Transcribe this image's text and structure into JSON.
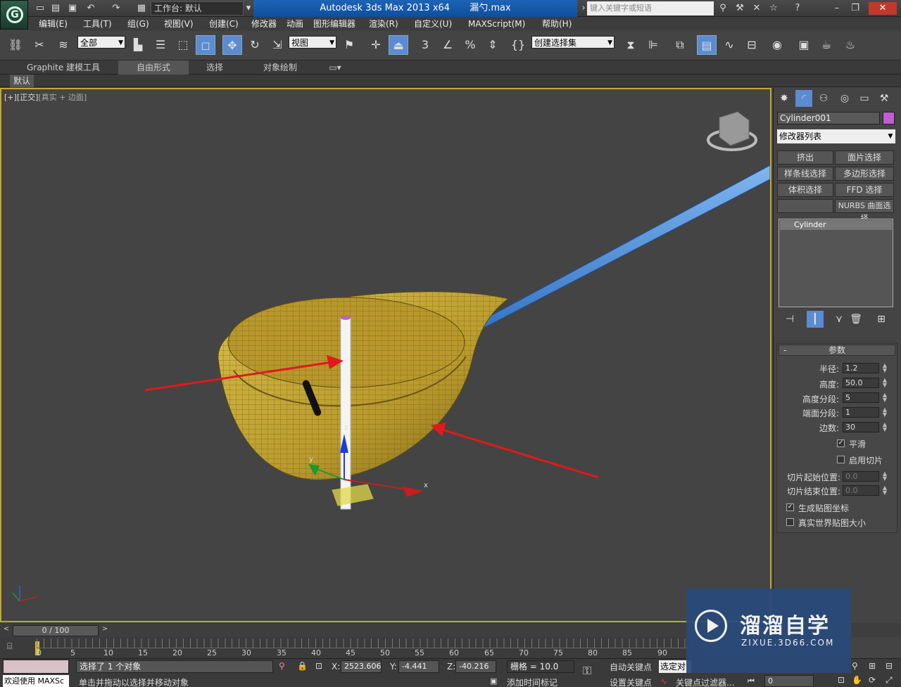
{
  "app": {
    "title": "Autodesk 3ds Max  2013 x64",
    "file": "漏勺.max",
    "workspace": "工作台: 默认",
    "search_placeholder": "键入关键字或短语",
    "logo_letter": "G"
  },
  "menus": [
    "编辑(E)",
    "工具(T)",
    "组(G)",
    "视图(V)",
    "创建(C)",
    "修改器",
    "动画",
    "图形编辑器",
    "渲染(R)",
    "自定义(U)",
    "MAXScript(M)",
    "帮助(H)"
  ],
  "toolbar": {
    "filter": "全部",
    "ref_coord": "视图",
    "named_selection": "创建选择集",
    "snap_3": "3",
    "snap_percent": "%"
  },
  "ribbon": {
    "tabs": [
      "Graphite 建模工具",
      "自由形式",
      "选择",
      "对象绘制"
    ],
    "sub_label": "默认"
  },
  "viewport": {
    "label_plus": "[+]",
    "label_view": "[正交]",
    "label_mode": "[真实 + 边面]",
    "gizmo_x": "x",
    "gizmo_y": "y",
    "gizmo_z": "z"
  },
  "command_panel": {
    "object_name": "Cylinder001",
    "object_color": "#c15fd1",
    "modifier_list": "修改器列表",
    "modifier_buttons": [
      "挤出",
      "面片选择",
      "样条线选择",
      "多边形选择",
      "体积选择",
      "FFD 选择",
      "",
      "NURBS 曲面选择"
    ],
    "stack_item": "Cylinder",
    "rollout_title": "参数",
    "rollout_toggle": "-",
    "params": [
      {
        "label": "半径:",
        "value": "1.2"
      },
      {
        "label": "高度:",
        "value": "50.0"
      },
      {
        "label": "高度分段:",
        "value": "5"
      },
      {
        "label": "端面分段:",
        "value": "1"
      },
      {
        "label": "边数:",
        "value": "30"
      }
    ],
    "smooth": {
      "label": "平滑",
      "checked": true
    },
    "slice_on": {
      "label": "启用切片",
      "checked": false
    },
    "slice_from": {
      "label": "切片起始位置:",
      "value": "0.0"
    },
    "slice_to": {
      "label": "切片结束位置:",
      "value": "0.0"
    },
    "gen_map": {
      "label": "生成贴图坐标",
      "checked": true
    },
    "real_world": {
      "label": "真实世界贴图大小",
      "checked": false
    }
  },
  "timeline": {
    "frame": "0 / 100",
    "ticks": [
      "0",
      "5",
      "10",
      "15",
      "20",
      "25",
      "30",
      "35",
      "40",
      "45",
      "50",
      "55",
      "60",
      "65",
      "70",
      "75",
      "80",
      "85",
      "90"
    ]
  },
  "status": {
    "selected": "选择了 1 个对象",
    "prompt": "单击并拖动以选择并移动对象",
    "welcome": "欢迎使用 MAXSc",
    "x_label": "X:",
    "x": "2523.606",
    "y_label": "Y:",
    "y": "-4.441",
    "z_label": "Z:",
    "z": "-40.216",
    "grid": "栅格 = 10.0",
    "auto_key": "自动关键点",
    "selected_obj": "选定对",
    "set_key": "设置关键点",
    "key_filter": "关键点过滤器...",
    "add_time_tag": "添加时间标记",
    "frame_field": "0"
  },
  "watermark": {
    "title": "溜溜自学",
    "url": "ZIXUE.3D66.COM"
  }
}
